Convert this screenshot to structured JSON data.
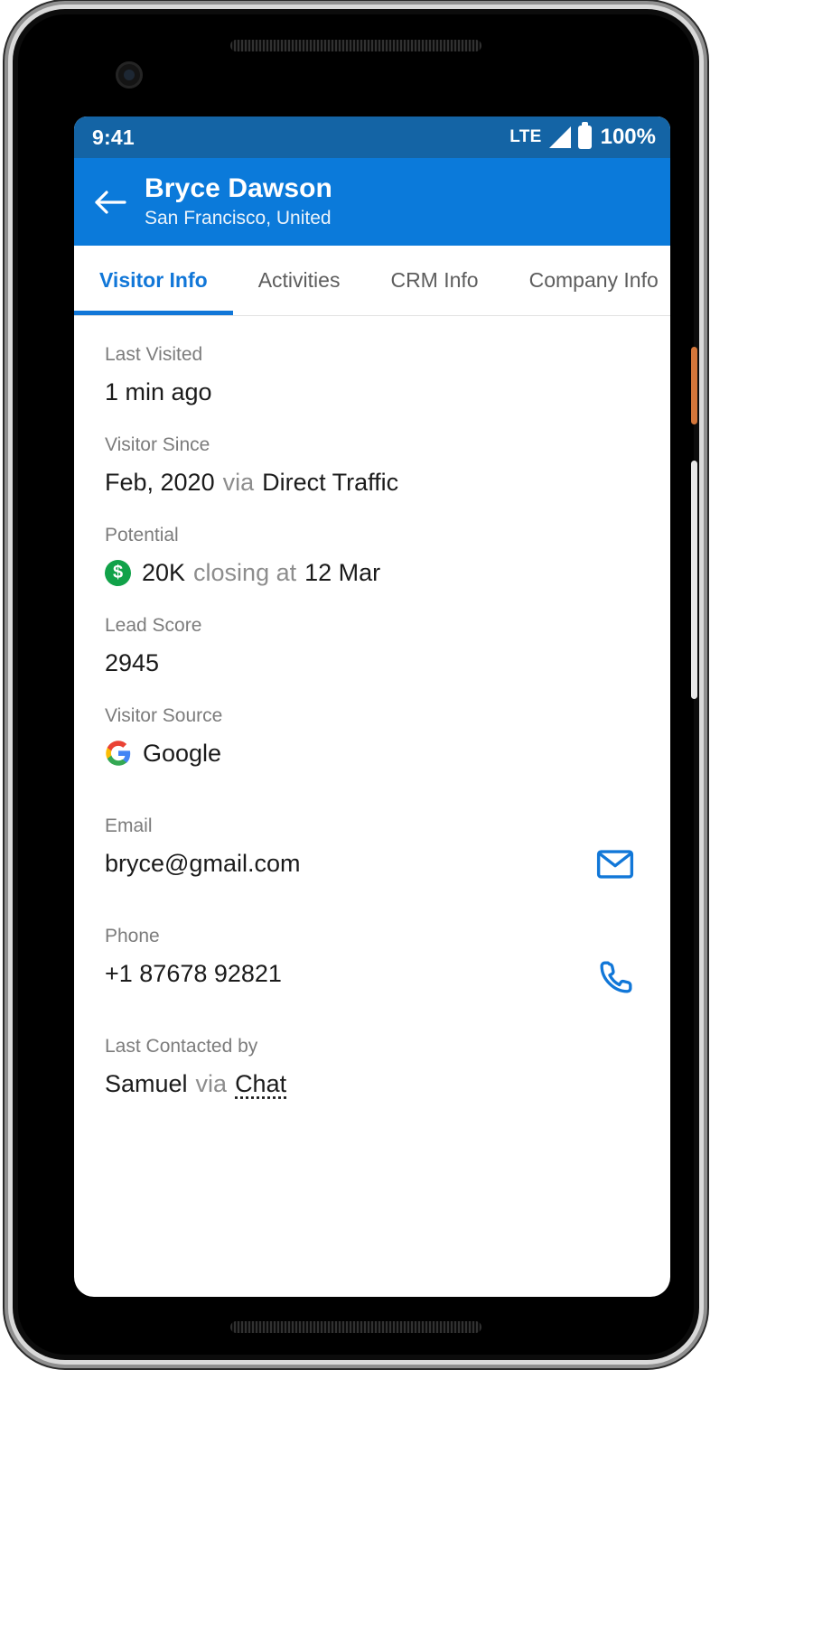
{
  "status_bar": {
    "time": "9:41",
    "network_label": "LTE",
    "signal_icon": "signal-triangle-icon",
    "battery_icon": "battery-full-icon",
    "battery_percent": "100%",
    "background_color": "#1464a5"
  },
  "app_bar": {
    "back_icon": "back-arrow-icon",
    "title": "Bryce Dawson",
    "subtitle": "San Francisco, United",
    "background_color": "#0b7ada"
  },
  "tabs": {
    "active_color": "#1177d8",
    "items": [
      {
        "label": "Visitor Info",
        "active": true
      },
      {
        "label": "Activities",
        "active": false
      },
      {
        "label": "CRM Info",
        "active": false
      },
      {
        "label": "Company Info",
        "active": false
      }
    ]
  },
  "fields": {
    "last_visited": {
      "label": "Last Visited",
      "value": "1 min ago"
    },
    "visitor_since": {
      "label": "Visitor Since",
      "date": "Feb, 2020",
      "connector": "via",
      "source": "Direct Traffic"
    },
    "potential": {
      "label": "Potential",
      "badge_icon": "dollar-badge-icon",
      "badge_glyph": "$",
      "badge_color": "#11a249",
      "amount": "20K",
      "connector": "closing at",
      "close_date": "12 Mar"
    },
    "lead_score": {
      "label": "Lead Score",
      "value": "2945"
    },
    "visitor_source": {
      "label": "Visitor Source",
      "icon": "google-logo-icon",
      "value": "Google"
    },
    "email": {
      "label": "Email",
      "value": "bryce@gmail.com",
      "action_icon": "mail-icon",
      "action_color": "#1177d8"
    },
    "phone": {
      "label": "Phone",
      "value": "+1 87678 92821",
      "action_icon": "phone-icon",
      "action_color": "#1177d8"
    },
    "last_contacted": {
      "label": "Last Contacted by",
      "person": "Samuel",
      "connector": "via",
      "channel": "Chat"
    }
  },
  "device": {
    "camera_icon": "front-camera-icon",
    "speaker_top_icon": "earpiece-speaker-icon",
    "speaker_bottom_icon": "bottom-speaker-icon",
    "power_button_icon": "power-button-icon",
    "volume_button_icon": "volume-rocker-icon"
  }
}
